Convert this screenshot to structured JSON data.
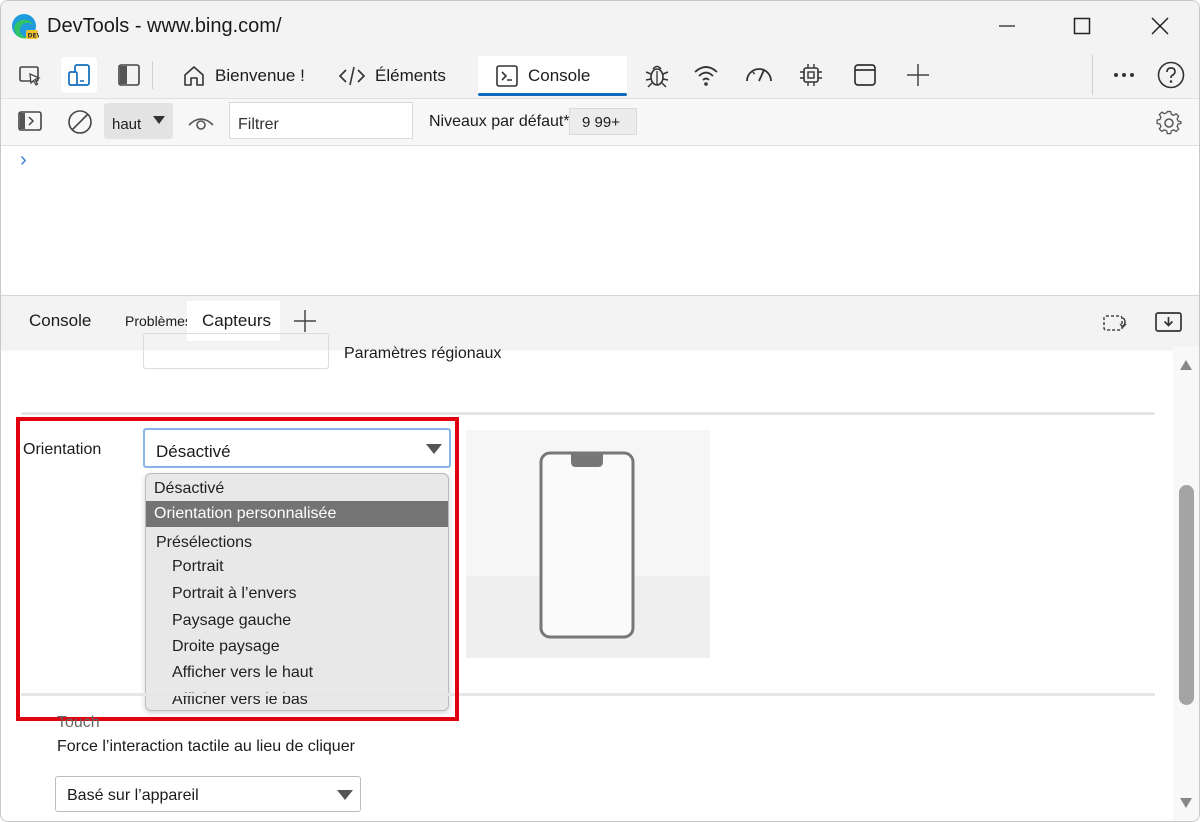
{
  "window": {
    "title": "DevTools - www.bing.com/",
    "icons": {
      "app": "edge-dev-logo-icon",
      "minimize": "minimize-icon",
      "maximize": "maximize-icon",
      "close": "close-icon"
    }
  },
  "tool_tabs": {
    "welcome": "Bienvenue !",
    "elements": "Éléments",
    "console": "Console",
    "active": "Console",
    "icons": [
      "inspect-icon",
      "device-emulation-icon",
      "dock-side-icon",
      "home-icon",
      "code-icon",
      "console-icon",
      "bug-icon",
      "wifi-icon",
      "performance-gauge-icon",
      "cpu-icon",
      "application-window-icon",
      "add-icon",
      "more-icon",
      "help-icon"
    ]
  },
  "console_toolbar": {
    "context": "haut",
    "filter_placeholder": "Filtrer",
    "levels_label": "Niveaux par défaut*",
    "issues_count": "9 99+"
  },
  "console": {
    "prompt": "›"
  },
  "drawer_tabs": {
    "console": "Console",
    "problems": "Problèmes",
    "sensors": "Capteurs",
    "active": "Capteurs"
  },
  "sensors": {
    "locale_label": "Paramètres régionaux",
    "orientation_label": "Orientation",
    "orientation_value": "Désactivé",
    "orientation_menu": {
      "off": "Désactivé",
      "custom": "Orientation personnalisée",
      "group_label": "Présélections",
      "presets": [
        "Portrait",
        "Portrait à l’envers",
        "Paysage gauche",
        "Droite paysage",
        "Afficher vers le haut",
        "Afficher vers le bas"
      ],
      "highlighted": "Orientation personnalisée"
    },
    "touch_title": "Touch",
    "touch_description": "Force l’interaction tactile au lieu de cliquer",
    "touch_value": "Basé sur l’appareil"
  },
  "colors": {
    "accent": "#0f6cbd",
    "highlight_frame": "#e0000f",
    "menu_highlight": "#747474"
  }
}
